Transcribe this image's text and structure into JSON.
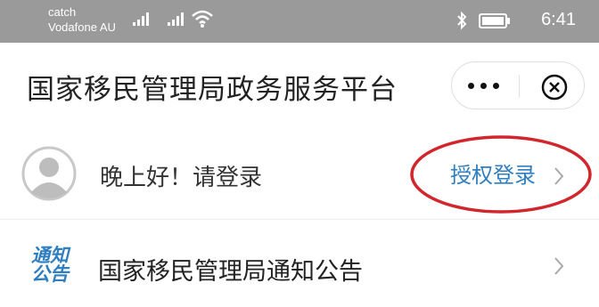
{
  "status_bar": {
    "carrier_line1": "catch",
    "carrier_line2": "Vodafone AU",
    "time": "6:41",
    "icons": [
      "signal-icon",
      "signal-icon",
      "wifi-icon",
      "bluetooth-icon",
      "battery-icon"
    ]
  },
  "title_bar": {
    "title": "国家移民管理局政务服务平台",
    "more_icon": "more-dots-icon",
    "close_icon": "close-circle-icon"
  },
  "login": {
    "greeting": "晚上好！请登录",
    "auth_button": "授权登录",
    "avatar_icon": "user-avatar-icon",
    "chevron_icon": "chevron-right-icon"
  },
  "notice": {
    "icon_line1": "通知",
    "icon_line2": "公告",
    "label": "国家移民管理局通知公告",
    "chevron_icon": "chevron-right-icon"
  },
  "colors": {
    "status_bar_bg": "#9a9a9a",
    "accent_blue": "#2f7fc0",
    "highlight_red": "#d0262c"
  }
}
